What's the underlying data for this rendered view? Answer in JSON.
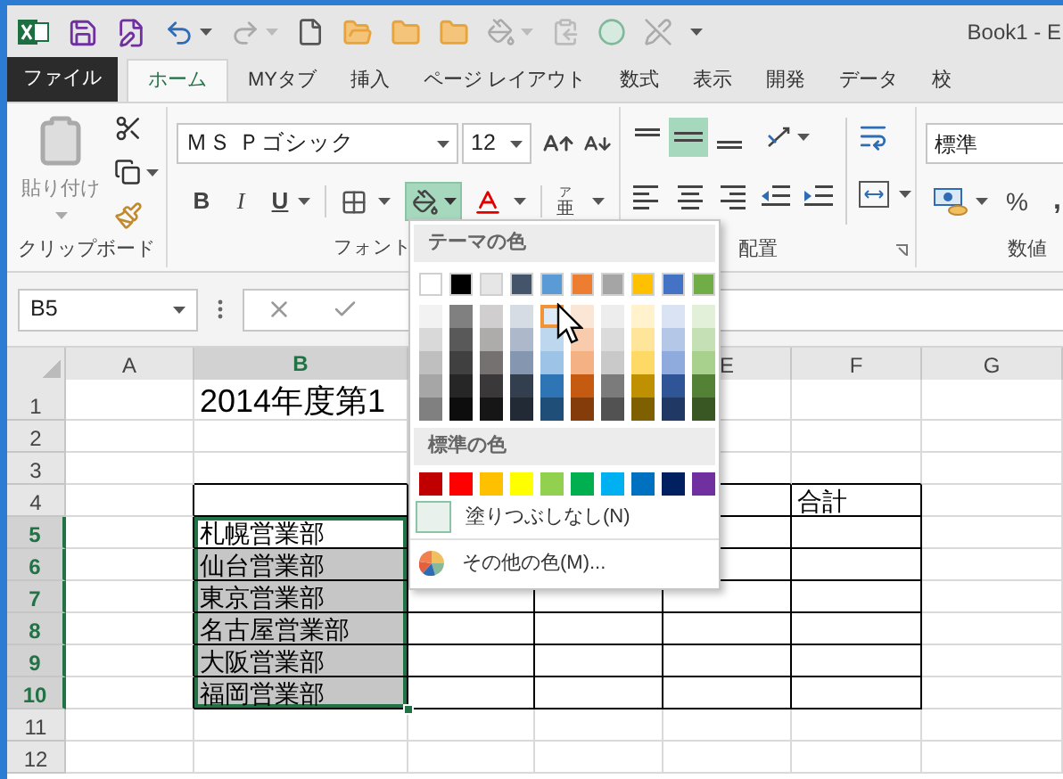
{
  "title_bar": {
    "title": "Book1 - E"
  },
  "tabs": [
    {
      "label": "ファイル",
      "kind": "file",
      "selected": false
    },
    {
      "label": "ホーム",
      "kind": "tab",
      "selected": true
    },
    {
      "label": "MYタブ",
      "kind": "tab",
      "selected": false
    },
    {
      "label": "挿入",
      "kind": "tab",
      "selected": false
    },
    {
      "label": "ページ レイアウト",
      "kind": "tab",
      "selected": false
    },
    {
      "label": "数式",
      "kind": "tab",
      "selected": false
    },
    {
      "label": "表示",
      "kind": "tab",
      "selected": false
    },
    {
      "label": "開発",
      "kind": "tab",
      "selected": false
    },
    {
      "label": "データ",
      "kind": "tab",
      "selected": false
    },
    {
      "label": "校",
      "kind": "tab",
      "selected": false
    }
  ],
  "ribbon": {
    "clipboard": {
      "paste_label": "貼り付け",
      "group_label": "クリップボード"
    },
    "font": {
      "font_name": "ＭＳ Ｐゴシック",
      "font_size": "12",
      "bold": "B",
      "italic": "I",
      "underline": "U",
      "phonetic_top": "ア",
      "phonetic_bottom": "亜",
      "fill_pressed": true,
      "group_label": "フォント"
    },
    "alignment": {
      "middle_selected": true,
      "group_label": "配置"
    },
    "number": {
      "format": "標準",
      "percent": "%",
      "comma": ",",
      "group_label": "数値"
    }
  },
  "formula_bar": {
    "name_box": "B5"
  },
  "sheet": {
    "columns": [
      {
        "kind": "header",
        "label": "A",
        "selected": false
      },
      {
        "kind": "header",
        "label": "B",
        "selected": true
      },
      {
        "kind": "covered"
      },
      {
        "kind": "covered"
      },
      {
        "kind": "header",
        "label": "E",
        "selected": false
      },
      {
        "kind": "header",
        "label": "F",
        "selected": false
      },
      {
        "kind": "header",
        "label": "G",
        "selected": false
      }
    ],
    "rows": [
      {
        "label": "1",
        "selected": false,
        "cells": [
          {},
          {
            "text": "2014年度第1"
          }
        ]
      },
      {
        "label": "2",
        "selected": false
      },
      {
        "label": "3",
        "selected": false
      },
      {
        "label": "4",
        "selected": false,
        "cells": [
          {},
          {
            "bordered": true
          },
          {},
          {},
          {
            "bordered": true
          },
          {
            "text": "合計",
            "bordered": true
          }
        ]
      },
      {
        "label": "5",
        "selected": true,
        "cells": [
          {},
          {
            "text": "札幌営業部",
            "selected": true,
            "active": true,
            "bordered": true
          },
          {},
          {},
          {
            "bordered": true
          },
          {
            "bordered": true
          }
        ]
      },
      {
        "label": "6",
        "selected": true,
        "cells": [
          {},
          {
            "text": "仙台営業部",
            "selected": true,
            "active": false,
            "bordered": true
          },
          {},
          {},
          {
            "bordered": true
          },
          {
            "bordered": true
          }
        ]
      },
      {
        "label": "7",
        "selected": true,
        "cells": [
          {},
          {
            "text": "東京営業部",
            "selected": true,
            "active": false,
            "bordered": true
          },
          {
            "bordered": true
          },
          {
            "bordered": true
          },
          {
            "bordered": true
          },
          {
            "bordered": true
          }
        ]
      },
      {
        "label": "8",
        "selected": true,
        "cells": [
          {},
          {
            "text": "名古屋営業部",
            "selected": true,
            "active": false,
            "bordered": true
          },
          {
            "bordered": true
          },
          {
            "bordered": true
          },
          {
            "bordered": true
          },
          {
            "bordered": true
          }
        ]
      },
      {
        "label": "9",
        "selected": true,
        "cells": [
          {},
          {
            "text": "大阪営業部",
            "selected": true,
            "active": false,
            "bordered": true
          },
          {
            "bordered": true
          },
          {
            "bordered": true
          },
          {
            "bordered": true
          },
          {
            "bordered": true
          }
        ]
      },
      {
        "label": "10",
        "selected": true,
        "cells": [
          {},
          {
            "text": "福岡営業部",
            "selected": true,
            "active": false,
            "bordered": true
          },
          {
            "bordered": true
          },
          {
            "bordered": true
          },
          {
            "bordered": true
          },
          {
            "bordered": true
          }
        ]
      },
      {
        "label": "11",
        "selected": false
      },
      {
        "label": "12",
        "selected": false
      }
    ]
  },
  "color_menu": {
    "theme_title": "テーマの色",
    "theme": [
      {
        "color": "#ffffff",
        "shades": [
          {
            "color": "#f2f2f2",
            "hovered": false
          },
          {
            "color": "#d9d9d9",
            "hovered": false
          },
          {
            "color": "#bfbfbf",
            "hovered": false
          },
          {
            "color": "#a6a6a6",
            "hovered": false
          },
          {
            "color": "#808080",
            "hovered": false
          }
        ]
      },
      {
        "color": "#000000",
        "shades": [
          {
            "color": "#808080",
            "hovered": false
          },
          {
            "color": "#595959",
            "hovered": false
          },
          {
            "color": "#404040",
            "hovered": false
          },
          {
            "color": "#262626",
            "hovered": false
          },
          {
            "color": "#0d0d0d",
            "hovered": false
          }
        ]
      },
      {
        "color": "#e7e6e6",
        "shades": [
          {
            "color": "#d0cece",
            "hovered": false
          },
          {
            "color": "#aeabab",
            "hovered": false
          },
          {
            "color": "#757171",
            "hovered": false
          },
          {
            "color": "#3a3838",
            "hovered": false
          },
          {
            "color": "#161616",
            "hovered": false
          }
        ]
      },
      {
        "color": "#44546a",
        "shades": [
          {
            "color": "#d6dce4",
            "hovered": false
          },
          {
            "color": "#adb9ca",
            "hovered": false
          },
          {
            "color": "#8496b0",
            "hovered": false
          },
          {
            "color": "#333f4f",
            "hovered": false
          },
          {
            "color": "#222a35",
            "hovered": false
          }
        ]
      },
      {
        "color": "#5b9bd5",
        "shades": [
          {
            "color": "#deebf6",
            "hovered": true
          },
          {
            "color": "#bdd7ee",
            "hovered": false
          },
          {
            "color": "#9dc3e6",
            "hovered": false
          },
          {
            "color": "#2e75b5",
            "hovered": false
          },
          {
            "color": "#1f4e79",
            "hovered": false
          }
        ]
      },
      {
        "color": "#ed7d31",
        "shades": [
          {
            "color": "#fbe5d5",
            "hovered": false
          },
          {
            "color": "#f7cbac",
            "hovered": false
          },
          {
            "color": "#f4b183",
            "hovered": false
          },
          {
            "color": "#c55a11",
            "hovered": false
          },
          {
            "color": "#843c0b",
            "hovered": false
          }
        ]
      },
      {
        "color": "#a5a5a5",
        "shades": [
          {
            "color": "#ededed",
            "hovered": false
          },
          {
            "color": "#dbdbdb",
            "hovered": false
          },
          {
            "color": "#c9c9c9",
            "hovered": false
          },
          {
            "color": "#7b7b7b",
            "hovered": false
          },
          {
            "color": "#525252",
            "hovered": false
          }
        ]
      },
      {
        "color": "#ffc000",
        "shades": [
          {
            "color": "#fff2cc",
            "hovered": false
          },
          {
            "color": "#fee599",
            "hovered": false
          },
          {
            "color": "#ffd965",
            "hovered": false
          },
          {
            "color": "#bf9000",
            "hovered": false
          },
          {
            "color": "#7f6000",
            "hovered": false
          }
        ]
      },
      {
        "color": "#4472c4",
        "shades": [
          {
            "color": "#dae3f3",
            "hovered": false
          },
          {
            "color": "#b4c7e7",
            "hovered": false
          },
          {
            "color": "#8faadc",
            "hovered": false
          },
          {
            "color": "#2f5597",
            "hovered": false
          },
          {
            "color": "#203864",
            "hovered": false
          }
        ]
      },
      {
        "color": "#70ad47",
        "shades": [
          {
            "color": "#e2f0d9",
            "hovered": false
          },
          {
            "color": "#c5e0b4",
            "hovered": false
          },
          {
            "color": "#a9d18e",
            "hovered": false
          },
          {
            "color": "#538135",
            "hovered": false
          },
          {
            "color": "#385723",
            "hovered": false
          }
        ]
      }
    ],
    "standard_title": "標準の色",
    "standard": [
      {
        "color": "#c00000"
      },
      {
        "color": "#ff0000"
      },
      {
        "color": "#ffc000"
      },
      {
        "color": "#ffff00"
      },
      {
        "color": "#92d050"
      },
      {
        "color": "#00b050"
      },
      {
        "color": "#00b0f0"
      },
      {
        "color": "#0070c0"
      },
      {
        "color": "#002060"
      },
      {
        "color": "#7030a0"
      }
    ],
    "no_fill": "塗りつぶしなし(N)",
    "more_colors": "その他の色(M)..."
  }
}
